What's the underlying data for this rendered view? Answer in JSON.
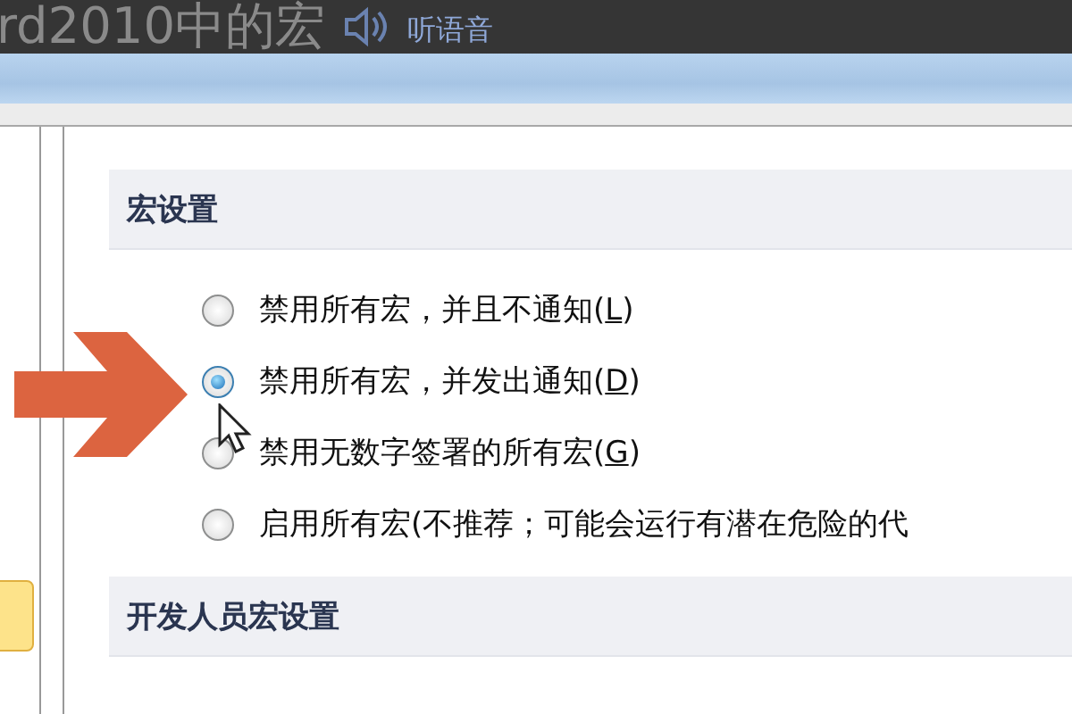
{
  "page_header": {
    "title": "rd2010中的宏",
    "audio_link": "听语音"
  },
  "sections": [
    {
      "title": "宏设置",
      "options": [
        {
          "label": "禁用所有宏，并且不通知(",
          "access_key": "L",
          "label_end": ")",
          "selected": false
        },
        {
          "label": "禁用所有宏，并发出通知(",
          "access_key": "D",
          "label_end": ")",
          "selected": true
        },
        {
          "label": "禁用无数字签署的所有宏(",
          "access_key": "G",
          "label_end": ")",
          "selected": false
        },
        {
          "label": "启用所有宏(不推荐；可能会运行有潜在危险的代",
          "selected": false
        }
      ]
    },
    {
      "title": "开发人员宏设置"
    }
  ]
}
